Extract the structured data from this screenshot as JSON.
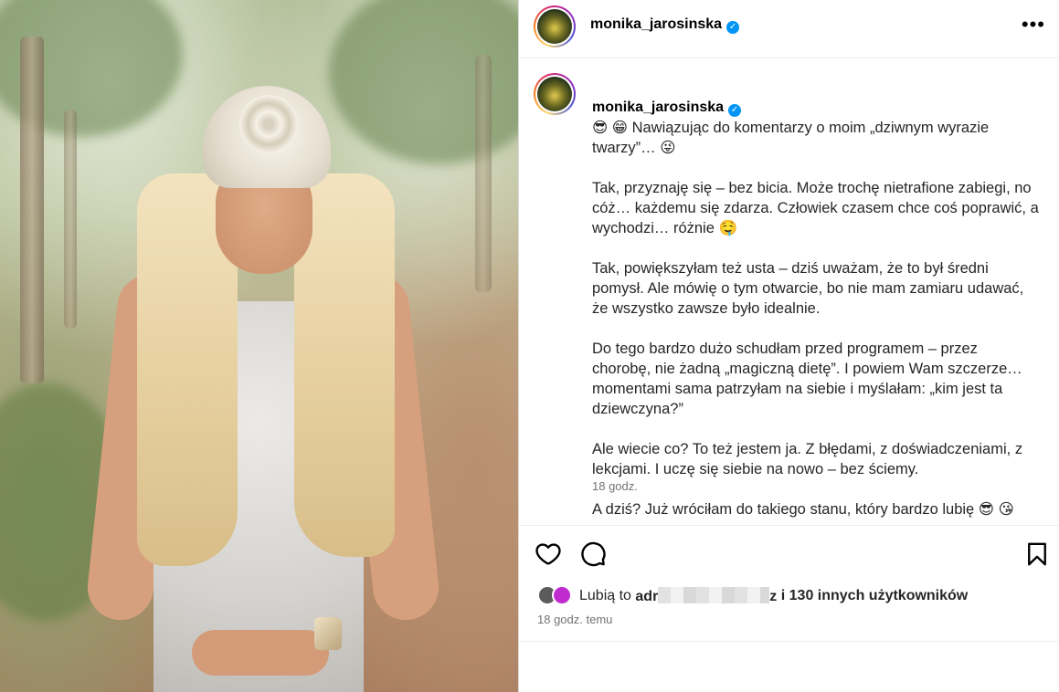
{
  "post": {
    "username": "monika_jarosinska",
    "verified_glyph": "✓",
    "more_glyph": "•••",
    "caption": {
      "first_line": "😎 😁 Nawiązując do komentarzy o moim „dziwnym wyrazie twarzy”… 😜",
      "paragraphs": [
        "Tak, przyznaję się – bez bicia. Może trochę nietrafione zabiegi, no cóż… każdemu się zdarza. Człowiek czasem chce coś poprawić, a wychodzi… różnie 🤤",
        "Tak, powiększyłam też usta – dziś uważam, że to był średni pomysł. Ale mówię o tym otwarcie, bo nie mam zamiaru udawać, że wszystko zawsze było idealnie.",
        "Do tego bardzo dużo schudłam przed programem – przez chorobę, nie żadną „magiczną dietę”. I powiem Wam szczerze… momentami sama patrzyłam na siebie i myślałam: „kim jest ta dziewczyna?”",
        "Ale wiecie co? To też jestem ja. Z błędami, z doświadczeniami, z lekcjami. I uczę się siebie na nowo – bez ściemy.",
        "A dziś? Już wróciłam do takiego stanu, który bardzo lubię 😎 😘"
      ],
      "time": "18 godz."
    },
    "likes": {
      "prefix": "Lubią to",
      "name_start": "adr",
      "name_end": "z",
      "suffix": "i 130 innych użytkowników"
    },
    "post_time": "18 godz. temu"
  },
  "icons": {
    "heart": "heart-icon",
    "comment": "comment-icon",
    "bookmark": "bookmark-icon",
    "more": "more-options-icon",
    "verified": "verified-badge-icon"
  },
  "colors": {
    "verified": "#0095f6",
    "text": "#262626",
    "secondary": "#737373",
    "divider": "#efefef"
  }
}
